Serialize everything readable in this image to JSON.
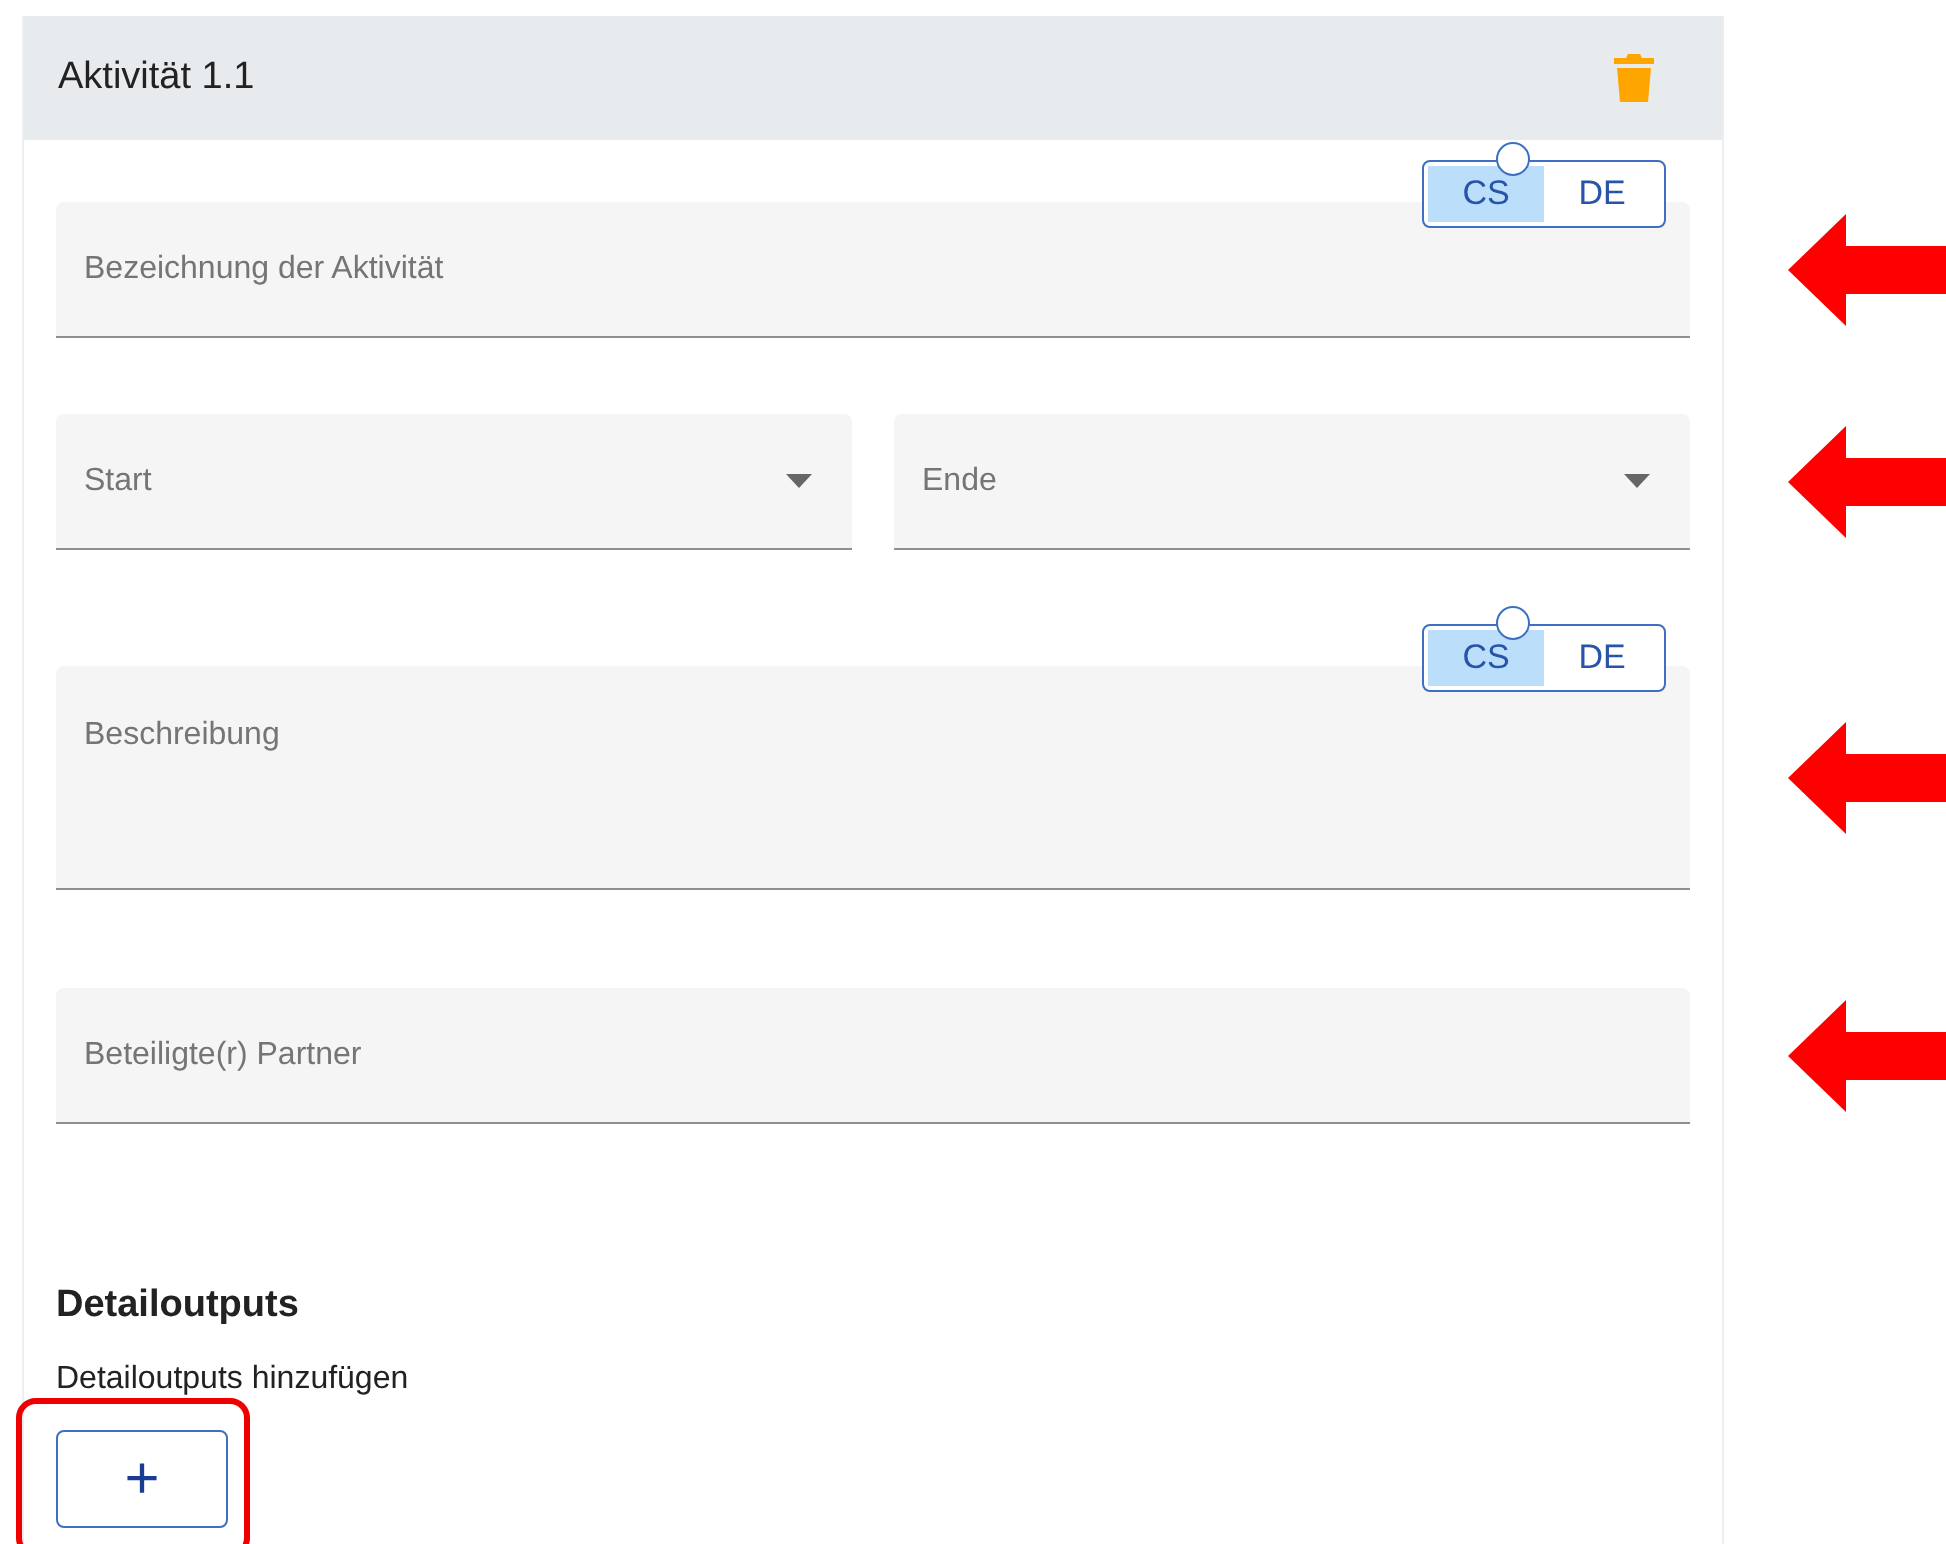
{
  "card": {
    "title": "Aktivität 1.1"
  },
  "rows": [
    {
      "marked": true,
      "fields": [
        {
          "kind": "text",
          "placeholder": "Bezeichnung der Aktivität",
          "languages": [
            {
              "label": "CS",
              "selected": true
            },
            {
              "label": "DE",
              "selected": false
            }
          ]
        }
      ]
    },
    {
      "marked": true,
      "fields": [
        {
          "kind": "select",
          "placeholder": "Start"
        },
        {
          "kind": "select",
          "placeholder": "Ende"
        }
      ]
    },
    {
      "marked": true,
      "fields": [
        {
          "kind": "textarea",
          "placeholder": "Beschreibung",
          "languages": [
            {
              "label": "CS",
              "selected": true
            },
            {
              "label": "DE",
              "selected": false
            }
          ]
        }
      ]
    },
    {
      "marked": true,
      "fields": [
        {
          "kind": "text",
          "placeholder": "Beteiligte(r) Partner"
        }
      ]
    }
  ],
  "section": {
    "title": "Detailoutputs",
    "hint": "Detailoutputs hinzufügen",
    "add_button": {
      "label": "+",
      "marked": true
    }
  }
}
